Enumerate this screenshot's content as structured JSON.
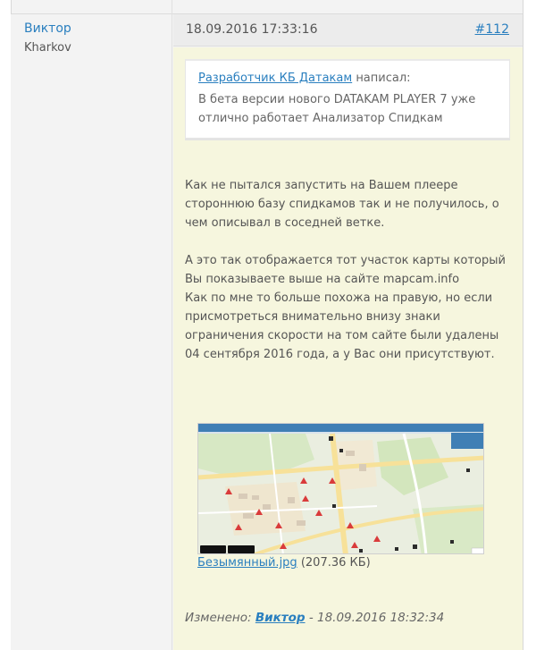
{
  "post": {
    "author": "Виктор",
    "author_location": "Kharkov",
    "date": "18.09.2016 17:33:16",
    "number": "#112",
    "quote": {
      "author": "Разработчик КБ Датакам",
      "wrote": "написал:",
      "text": "В бета версии нового DATAKAM PLAYER 7 уже отлично работает Анализатор Спидкам"
    },
    "paragraph1": "Как не пытался запустить на Вашем плеере стороннюю базу спидкамов так и не получилось, о чем описывал в соседней ветке.",
    "paragraph2": "А это так отображается тот участок карты который Вы показываете выше на сайте mapcam.info\nКак по мне то больше похожа на правую, но если присмотреться внимательно внизу знаки ограничения скорости на том сайте были удалены 04 сентября 2016 года, а у Вас они присутствуют.",
    "attachment": {
      "filename": "Безымянный.jpg",
      "size": "(207.36 КБ)",
      "image_icon": "map-screenshot-thumbnail",
      "badges": [
        "GooglePlay",
        "AppStore"
      ]
    },
    "edited": {
      "label": "Изменено:",
      "by": "Виктор",
      "sep": " - ",
      "when": "18.09.2016 18:32:34"
    }
  },
  "colors": {
    "link": "#2a7fbf",
    "post_body_bg": "#f6f6de",
    "header_bg": "#ececec"
  }
}
